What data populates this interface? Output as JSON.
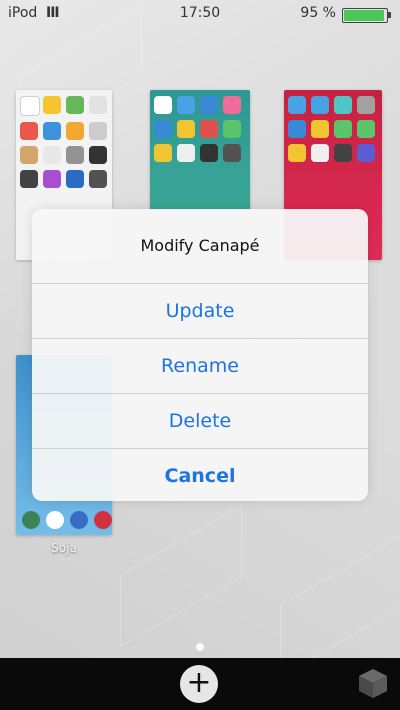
{
  "status_bar": {
    "carrier": "iPod",
    "signal": "III",
    "time": "17:50",
    "battery_percent": "95 %",
    "battery_level": 0.95
  },
  "alert": {
    "title": "Modify Canapé",
    "buttons": [
      "Update",
      "Rename",
      "Delete",
      "Cancel"
    ]
  },
  "thumbnails": [
    {
      "label": ""
    },
    {
      "label": ""
    },
    {
      "label": ""
    },
    {
      "label": "Soja"
    }
  ],
  "bottom_bar": {
    "add_icon": "plus-icon",
    "box_icon": "cube-icon"
  },
  "colors": {
    "accent": "#1a74e8",
    "battery": "#3cc24a"
  }
}
